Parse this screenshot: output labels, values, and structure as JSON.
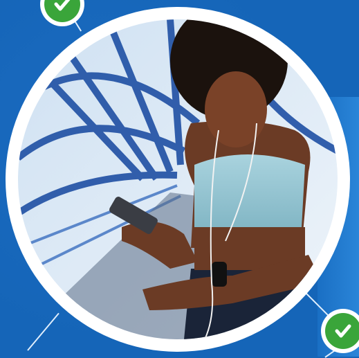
{
  "image": {
    "subject": "fitness-promo-graphic",
    "accent_blue": "#1565b8",
    "check_green": "#3aa53a",
    "ring_white": "#ffffff"
  },
  "icons": [
    "checkmark-icon",
    "checkmark-icon"
  ]
}
